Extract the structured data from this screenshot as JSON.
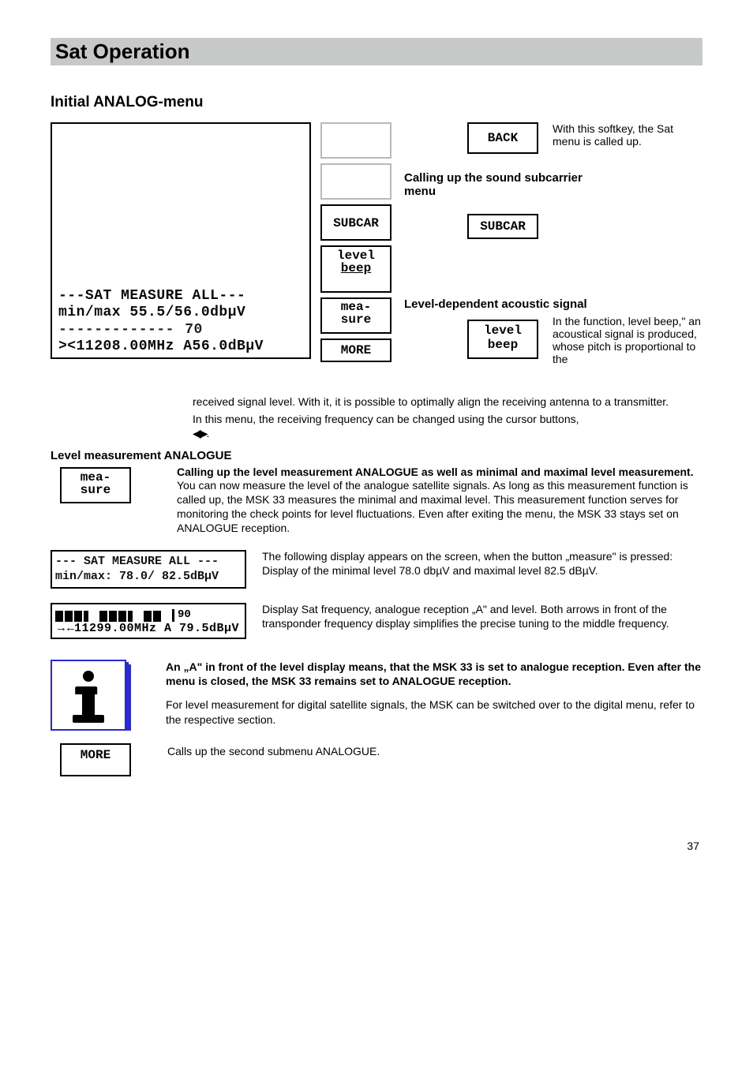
{
  "page_title": "Sat Operation",
  "section_heading": "Initial ANALOG-menu",
  "lcd_main": {
    "line1": "---SAT MEASURE ALL---",
    "line2": "min/max 55.5/56.0dbµV",
    "line3": "-------------    70",
    "line4": "><11208.00MHz A56.0dBµV"
  },
  "softkeys_col1": {
    "subcar": "SUBCAR",
    "level": "level",
    "beep": "beep",
    "measure1": "mea-",
    "measure2": "sure",
    "more": "MORE"
  },
  "softkeys_col2": {
    "back": "BACK",
    "subcar": "SUBCAR",
    "level": "level",
    "beep": "beep"
  },
  "desc_back": "With this softkey, the Sat menu is called up.",
  "desc_subcar_head1": "Calling up the sound subcarrier",
  "desc_subcar_head2": "menu",
  "desc_level_head": "Level-dependent acoustic signal",
  "desc_level_body": "In the function, level beep,\"  an acoustical signal is produced, whose pitch is proportional to the",
  "para_after_fig1": "received signal level.  With it, it is possible to optimally align the receiving antenna to a transmitter.",
  "para_after_fig2": "In this menu, the receiving frequency can be changed using the cursor buttons,",
  "arrows_lr": "◀▶.",
  "level_heading": "Level measurement ANALOGUE",
  "sk_measure": {
    "l1": "mea-",
    "l2": "sure"
  },
  "level_bold": "Calling up the level measurement ANALOGUE as well as minimal and maximal level measurement.",
  "level_body": "You can now measure the level of the analogue satellite signals. As long as this measurement function is called up, the MSK 33 measures the minimal and maximal level. This measurement function serves for monitoring the check points for level fluctuations. Even after exiting the menu, the MSK 33 stays set on ANALOGUE reception.",
  "lcd_small_1": {
    "l1": "--- SAT MEASURE ALL ---",
    "l2": "min/max: 78.0/ 82.5dBµV"
  },
  "small1_text": "The following display appears on the screen, when the button „measure\" is pressed: Display of the minimal level 78.0 dbµV and maximal level 82.5 dBµV.",
  "bar_display": {
    "num": "90",
    "line2_arrow_lead": "→←",
    "line2": "11299.00MHz A 79.5dBµV"
  },
  "bar_text": "Display Sat frequency, analogue reception „A\" and level. Both arrows in front of the transponder frequency display simplifies the precise tuning to the middle frequency.",
  "info_bold": "An „A\" in front of the level display means, that the MSK 33 is set to analogue reception.  Even after the menu is closed, the MSK 33 remains set to ANALOGUE reception.",
  "info_para": "For level measurement for digital satellite signals, the MSK can be switched over to the digital menu, refer to the respective section.",
  "sk_more2": "MORE",
  "more2_text": "Calls up the second submenu ANALOGUE.",
  "page_number": "37"
}
